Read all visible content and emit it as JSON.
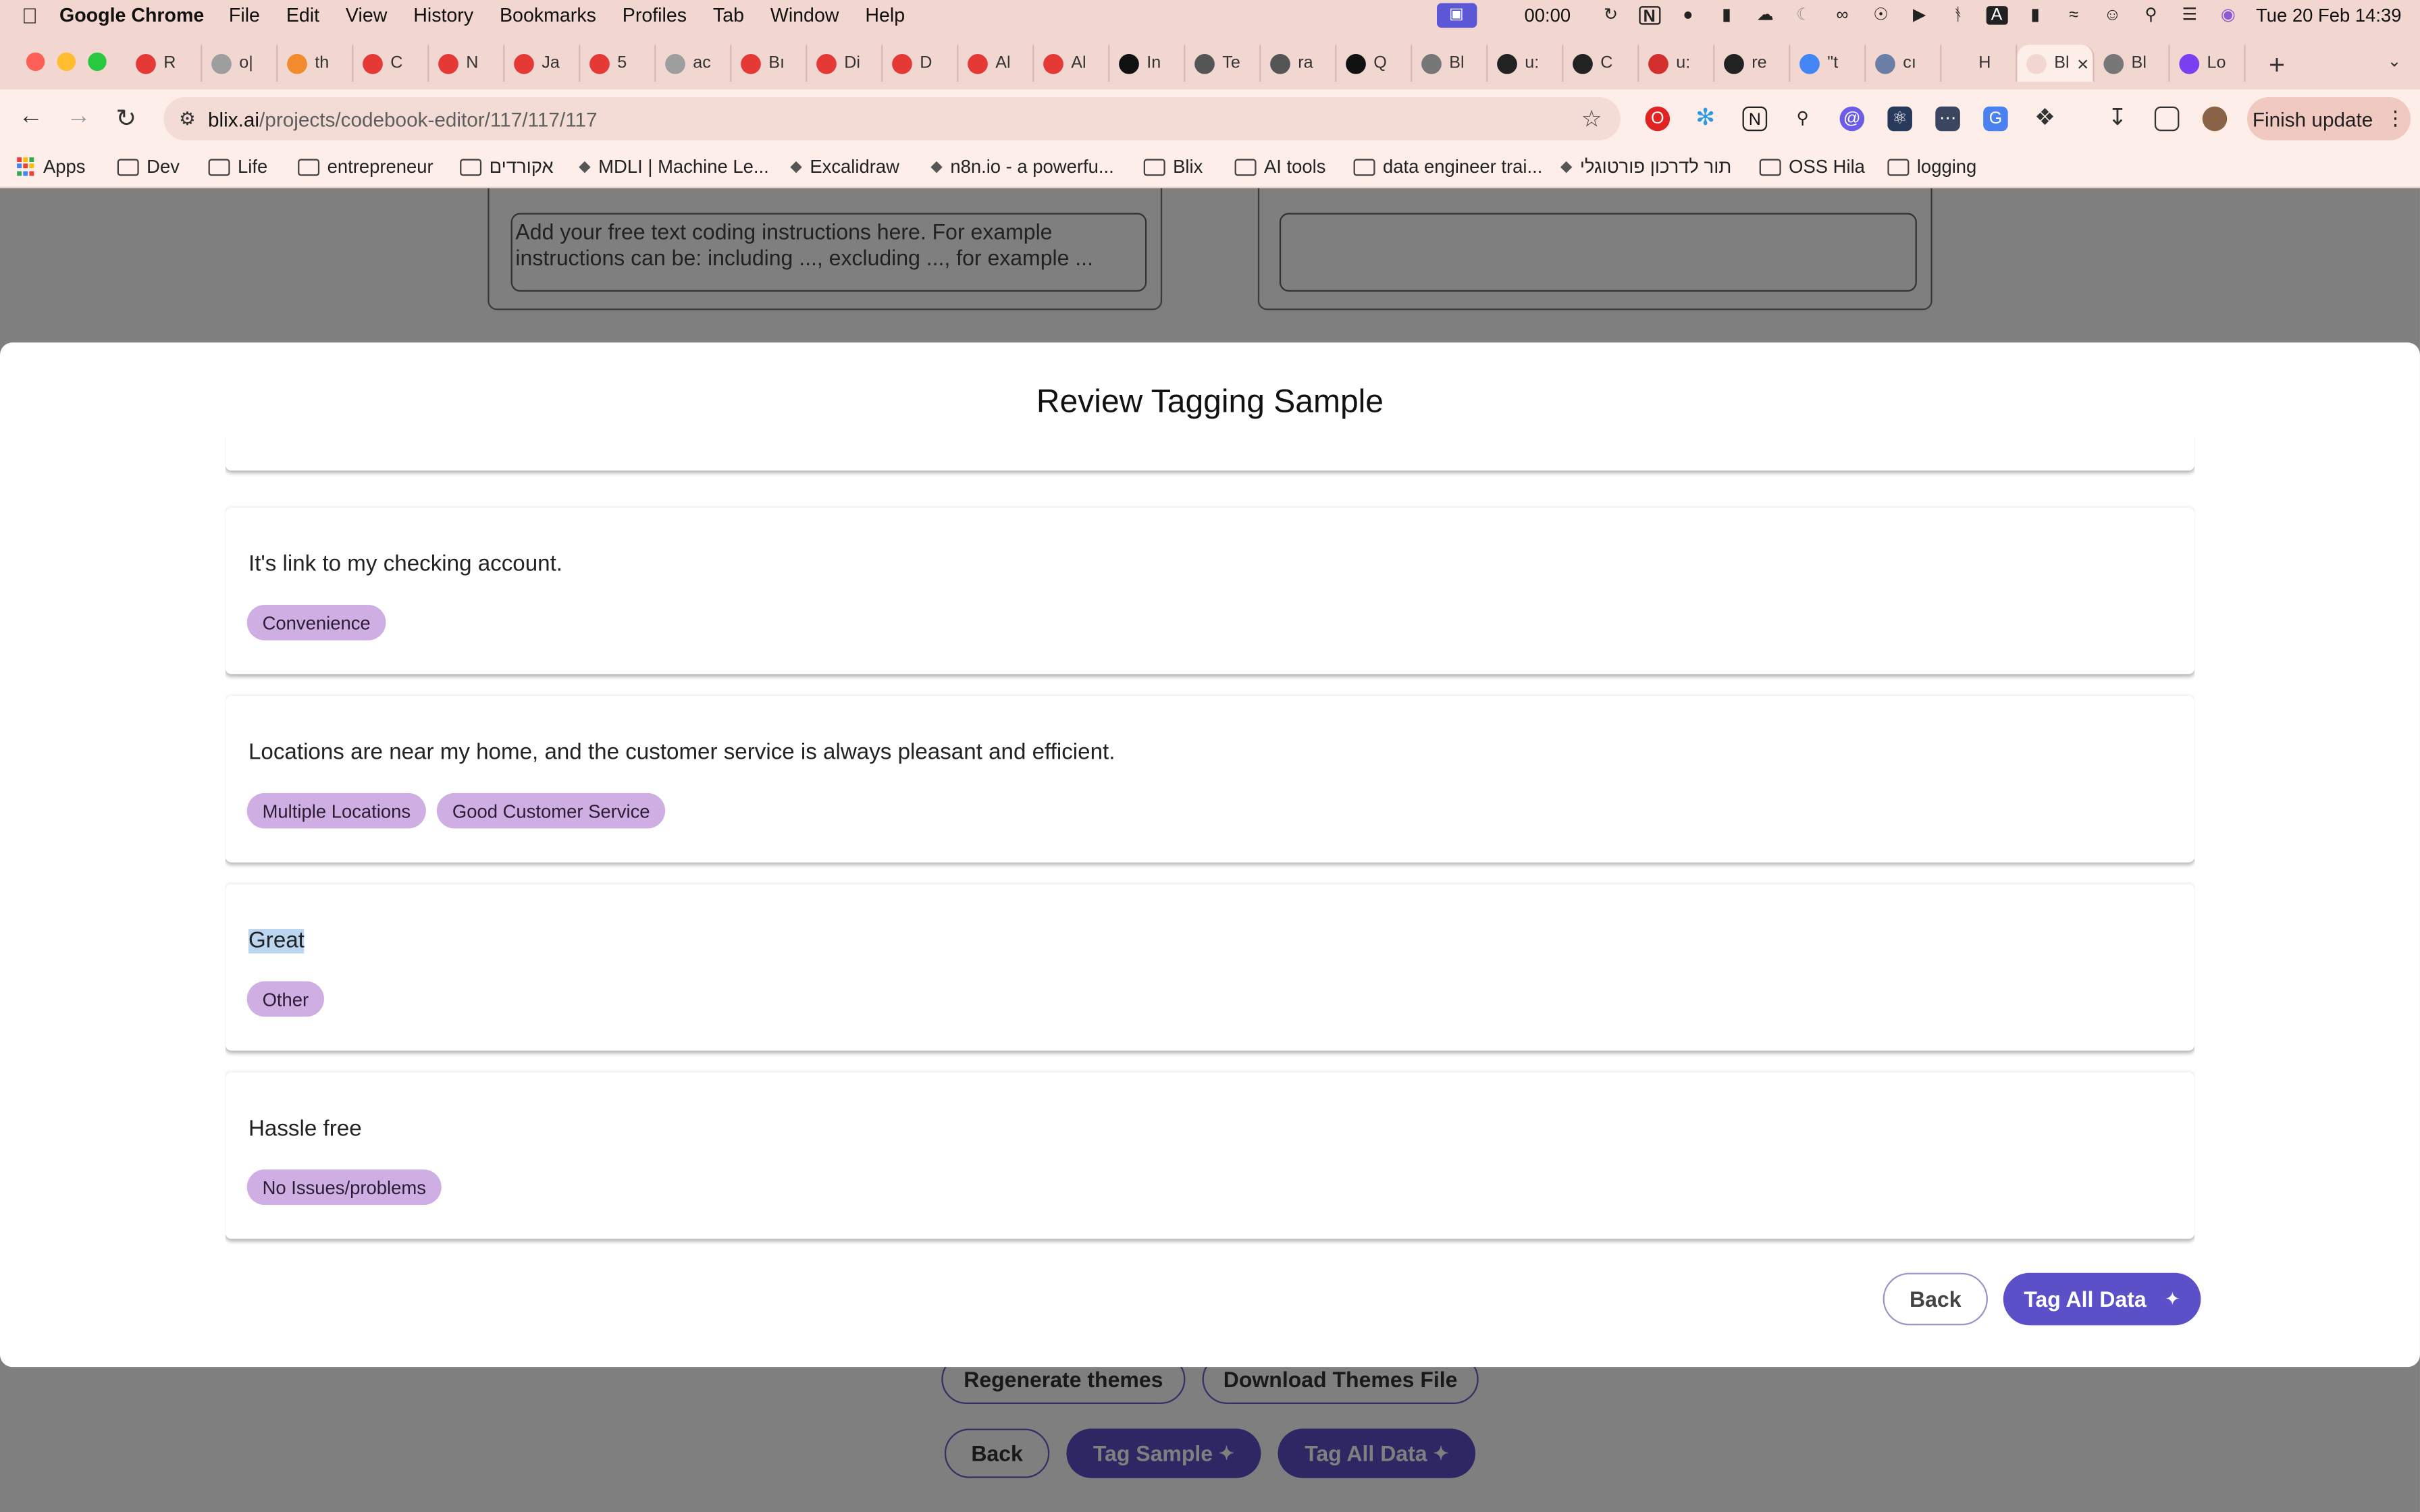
{
  "menubar": {
    "app_name": "Google Chrome",
    "items": [
      "File",
      "Edit",
      "View",
      "History",
      "Bookmarks",
      "Profiles",
      "Tab",
      "Window",
      "Help"
    ],
    "clock": "00:00",
    "datetime": "Tue 20 Feb  14:39"
  },
  "tabs": [
    {
      "label": "R",
      "color": "#e53935"
    },
    {
      "label": "o|",
      "color": "#9e9e9e"
    },
    {
      "label": "th",
      "color": "#f28b2e"
    },
    {
      "label": "C",
      "color": "#e53935"
    },
    {
      "label": "N",
      "color": "#e53935"
    },
    {
      "label": "Ja",
      "color": "#e53935"
    },
    {
      "label": "5",
      "color": "#e53935"
    },
    {
      "label": "ac",
      "color": "#9e9e9e"
    },
    {
      "label": "Bı",
      "color": "#e53935"
    },
    {
      "label": "Di",
      "color": "#e53935"
    },
    {
      "label": "D",
      "color": "#e53935"
    },
    {
      "label": "Al",
      "color": "#e53935"
    },
    {
      "label": "Al",
      "color": "#e53935"
    },
    {
      "label": "In",
      "color": "#111111"
    },
    {
      "label": "Te",
      "color": "#555555"
    },
    {
      "label": "ra",
      "color": "#555555"
    },
    {
      "label": "Q",
      "color": "#111111"
    },
    {
      "label": "Bl",
      "color": "#777777"
    },
    {
      "label": "u:",
      "color": "#222222"
    },
    {
      "label": "C",
      "color": "#222222"
    },
    {
      "label": "u:",
      "color": "#d32f2f"
    },
    {
      "label": "re",
      "color": "#222222"
    },
    {
      "label": "\"t",
      "color": "#4285f4"
    },
    {
      "label": "cı",
      "color": "#6b7fa6"
    },
    {
      "label": "H",
      "color": "#f2d6d0"
    },
    {
      "label": "Bl",
      "color": "#f2d6d0",
      "active": true
    },
    {
      "label": "Bl",
      "color": "#777777"
    },
    {
      "label": "Lo",
      "color": "#7b3ff2"
    }
  ],
  "toolbar": {
    "url_host": "blix.ai",
    "url_path": "/projects/codebook-editor/117/117/117",
    "finish_update": "Finish update"
  },
  "bookmarks": [
    {
      "label": "Apps",
      "type": "apps"
    },
    {
      "label": "Dev",
      "type": "folder"
    },
    {
      "label": "Life",
      "type": "folder"
    },
    {
      "label": "entrepreneur",
      "type": "folder"
    },
    {
      "label": "אקורדים",
      "type": "folder"
    },
    {
      "label": "MDLI | Machine Le...",
      "type": "link"
    },
    {
      "label": "Excalidraw",
      "type": "link"
    },
    {
      "label": "n8n.io - a powerfu...",
      "type": "link"
    },
    {
      "label": "Blix",
      "type": "folder"
    },
    {
      "label": "AI tools",
      "type": "folder"
    },
    {
      "label": "data engineer trai...",
      "type": "folder"
    },
    {
      "label": "תור לדרכון פורטוגלי",
      "type": "link"
    },
    {
      "label": "OSS Hila",
      "type": "folder"
    },
    {
      "label": "logging",
      "type": "folder"
    }
  ],
  "background": {
    "instructions_placeholder": "Add your free text coding instructions here. For example instructions can be: including ..., excluding ..., for example ...",
    "regenerate": "Regenerate themes",
    "download": "Download Themes File",
    "back": "Back",
    "tag_sample": "Tag Sample",
    "tag_all": "Tag All Data"
  },
  "modal": {
    "title": "Review Tagging Sample",
    "samples": [
      {
        "text": "",
        "tags": [
          ""
        ]
      },
      {
        "text": "It's link to my checking account.",
        "tags": [
          "Convenience"
        ]
      },
      {
        "text": "Locations are near my home, and the customer service is always pleasant and efficient.",
        "tags": [
          "Multiple Locations",
          "Good Customer Service"
        ]
      },
      {
        "text": "Great",
        "tags": [
          "Other"
        ],
        "highlighted": true
      },
      {
        "text": "Hassle free",
        "tags": [
          "No Issues/problems"
        ]
      }
    ],
    "back": "Back",
    "tag_all": "Tag All Data",
    "accent": "#5b50c7",
    "chip_color": "#cfaee3"
  }
}
